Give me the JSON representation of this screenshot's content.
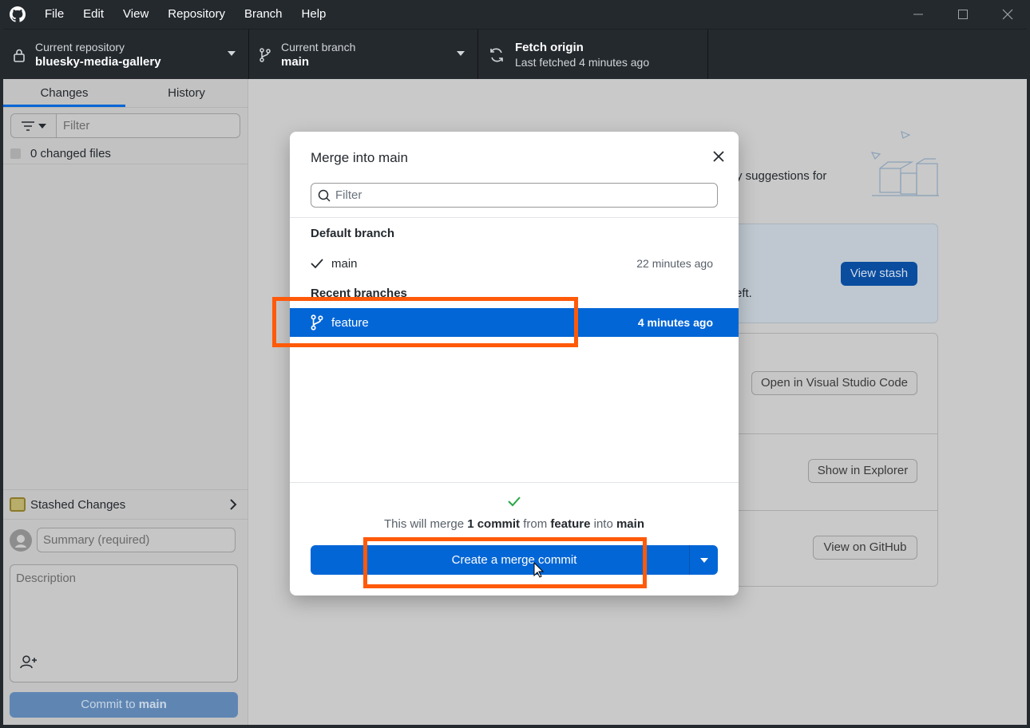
{
  "menu": [
    "File",
    "Edit",
    "View",
    "Repository",
    "Branch",
    "Help"
  ],
  "toolbar": {
    "repo_label": "Current repository",
    "repo_value": "bluesky-media-gallery",
    "branch_label": "Current branch",
    "branch_value": "main",
    "fetch_label": "Fetch origin",
    "fetch_sub": "Last fetched 4 minutes ago"
  },
  "sidebar": {
    "tabs": [
      "Changes",
      "History"
    ],
    "filter_placeholder": "Filter",
    "changed_files": "0 changed files",
    "stashed": "Stashed Changes",
    "summary_placeholder": "Summary (required)",
    "description_placeholder": "Description",
    "commit_prefix": "Commit to ",
    "commit_branch": "main"
  },
  "background": {
    "suggest_fragment": "y suggestions for",
    "stash_fragment": "eft.",
    "view_stash": "View stash",
    "open_vscode": "Open in Visual Studio Code",
    "show_explorer": "Show in Explorer",
    "view_github": "View on GitHub"
  },
  "dialog": {
    "title_prefix": "Merge into ",
    "title_branch": "main",
    "filter_placeholder": "Filter",
    "default_group": "Default branch",
    "recent_group": "Recent branches",
    "default_branch": {
      "name": "main",
      "time": "22 minutes ago"
    },
    "recent_branch": {
      "name": "feature",
      "time": "4 minutes ago"
    },
    "merge_info": {
      "p1": "This will merge ",
      "count": "1 commit",
      "p2": " from ",
      "source": "feature",
      "p3": " into ",
      "target": "main"
    },
    "merge_button": "Create a merge commit"
  },
  "colors": {
    "accent": "#0366d6",
    "highlight": "#ff5a0a",
    "success": "#28a745"
  }
}
